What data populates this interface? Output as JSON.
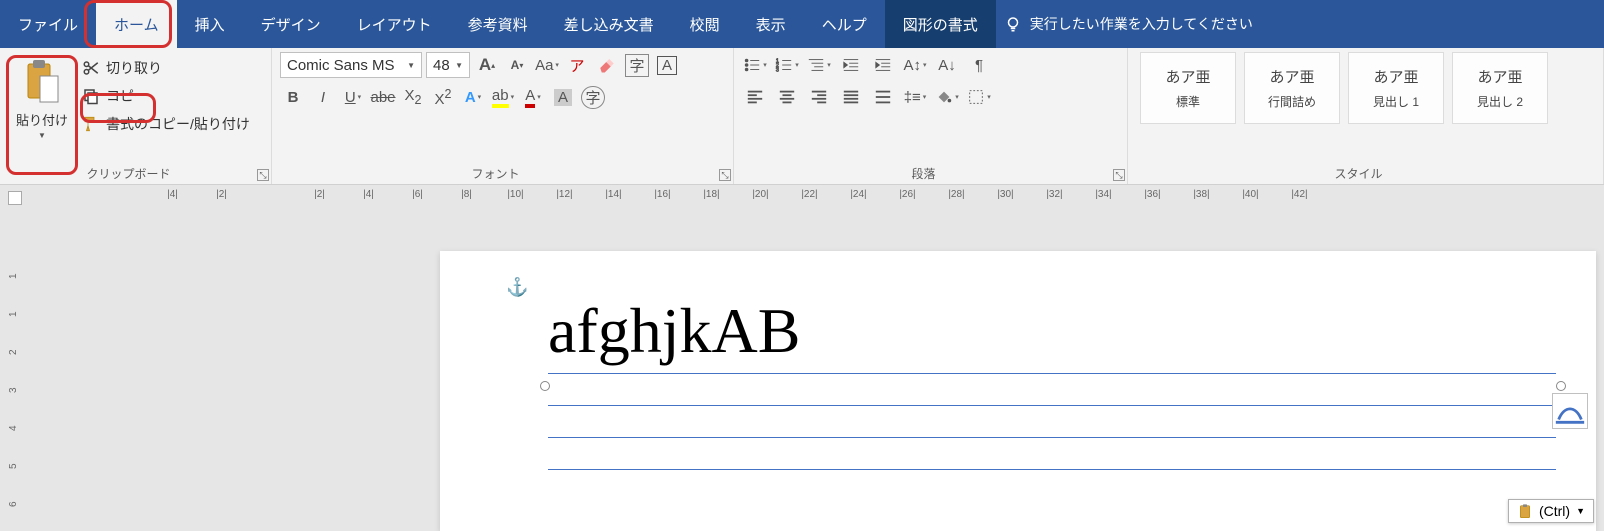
{
  "tabs": {
    "file": "ファイル",
    "home": "ホーム",
    "insert": "挿入",
    "design": "デザイン",
    "layout": "レイアウト",
    "references": "参考資料",
    "mailings": "差し込み文書",
    "review": "校閲",
    "view": "表示",
    "help": "ヘルプ",
    "shape_format": "図形の書式",
    "tell_me": "実行したい作業を入力してください"
  },
  "clipboard": {
    "paste": "貼り付け",
    "cut": "切り取り",
    "copy": "コピー",
    "format_painter": "書式のコピー/貼り付け",
    "group_label": "クリップボード"
  },
  "font": {
    "name": "Comic Sans MS",
    "size": "48",
    "group_label": "フォント"
  },
  "paragraph": {
    "group_label": "段落"
  },
  "styles": {
    "group_label": "スタイル",
    "sample": "あア亜",
    "items": [
      "標準",
      "行間詰め",
      "見出し 1",
      "見出し 2"
    ]
  },
  "ruler": {
    "h": [
      "|4|",
      "|2|",
      "",
      "|2|",
      "|4|",
      "|6|",
      "|8|",
      "|10|",
      "|12|",
      "|14|",
      "|16|",
      "|18|",
      "|20|",
      "|22|",
      "|24|",
      "|26|",
      "|28|",
      "|30|",
      "|32|",
      "|34|",
      "|36|",
      "|38|",
      "|40|",
      "|42|"
    ],
    "v": [
      "1",
      "1",
      "2",
      "3",
      "4",
      "5",
      "6"
    ]
  },
  "document": {
    "text": "afghjkAB"
  },
  "paste_options": {
    "label": "(Ctrl)"
  }
}
